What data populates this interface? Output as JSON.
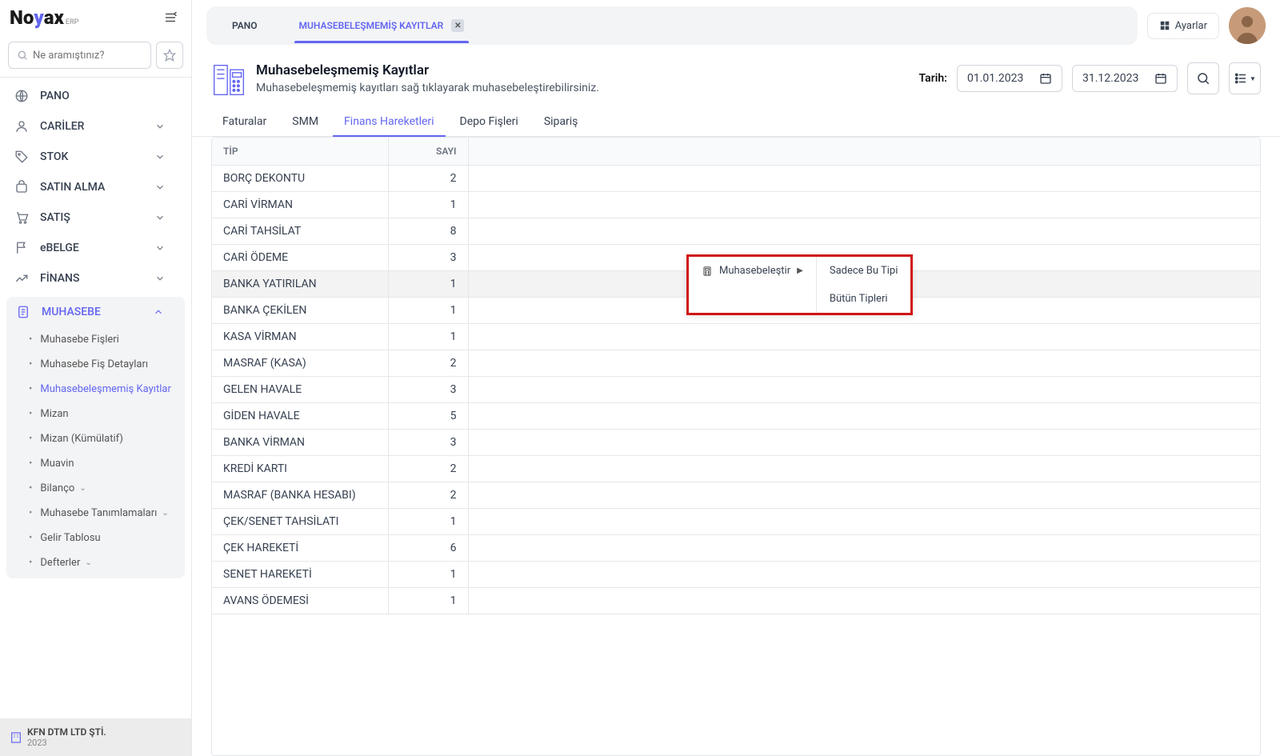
{
  "logo": {
    "part1": "No",
    "part2": "y",
    "part3": "ax",
    "erp": "ERP"
  },
  "search": {
    "placeholder": "Ne aramıştınız?"
  },
  "nav": {
    "pano": "PANO",
    "cariler": "CARİLER",
    "stok": "STOK",
    "satinalma": "SATIN ALMA",
    "satis": "SATIŞ",
    "ebelge": "eBELGE",
    "finans": "FİNANS",
    "muhasebe": "MUHASEBE"
  },
  "muhasebe_sub": {
    "fisler": "Muhasebe Fişleri",
    "fisdetay": "Muhasebe Fiş Detayları",
    "kayitlar": "Muhasebeleşmemiş Kayıtlar",
    "mizan": "Mizan",
    "mizankum": "Mizan (Kümülatif)",
    "muavin": "Muavin",
    "bilanco": "Bilanço",
    "tanimlamalar": "Muhasebe Tanımlamaları",
    "gelir": "Gelir Tablosu",
    "defterler": "Defterler"
  },
  "company": {
    "name": "KFN DTM LTD ŞTİ.",
    "year": "2023"
  },
  "tabs": {
    "pano": "PANO",
    "kayitlar": "MUHASEBELEŞMEMİŞ KAYITLAR"
  },
  "settings": "Ayarlar",
  "page": {
    "title": "Muhasebeleşmemiş Kayıtlar",
    "sub": "Muhasebeleşmemiş kayıtları sağ tıklayarak muhasebeleştirebilirsiniz."
  },
  "date": {
    "label": "Tarih:",
    "from": "01.01.2023",
    "to": "31.12.2023"
  },
  "subtabs": {
    "faturalar": "Faturalar",
    "smm": "SMM",
    "finans": "Finans Hareketleri",
    "depo": "Depo Fişleri",
    "siparis": "Sipariş"
  },
  "cols": {
    "tip": "TİP",
    "sayi": "SAYI"
  },
  "rows": [
    {
      "tip": "BORÇ DEKONTU",
      "sayi": "2",
      "hl": false
    },
    {
      "tip": "CARİ VİRMAN",
      "sayi": "1",
      "hl": false
    },
    {
      "tip": "CARİ TAHSİLAT",
      "sayi": "8",
      "hl": false
    },
    {
      "tip": "CARİ ÖDEME",
      "sayi": "3",
      "hl": false
    },
    {
      "tip": "BANKA YATIRILAN",
      "sayi": "1",
      "hl": true
    },
    {
      "tip": "BANKA ÇEKİLEN",
      "sayi": "1",
      "hl": false
    },
    {
      "tip": "KASA VİRMAN",
      "sayi": "1",
      "hl": false
    },
    {
      "tip": "MASRAF (KASA)",
      "sayi": "2",
      "hl": false
    },
    {
      "tip": "GELEN HAVALE",
      "sayi": "3",
      "hl": false
    },
    {
      "tip": "GİDEN HAVALE",
      "sayi": "5",
      "hl": false
    },
    {
      "tip": "BANKA VİRMAN",
      "sayi": "3",
      "hl": false
    },
    {
      "tip": "KREDİ KARTI",
      "sayi": "2",
      "hl": false
    },
    {
      "tip": "MASRAF (BANKA HESABI)",
      "sayi": "2",
      "hl": false
    },
    {
      "tip": "ÇEK/SENET TAHSİLATI",
      "sayi": "1",
      "hl": false
    },
    {
      "tip": "ÇEK HAREKETİ",
      "sayi": "6",
      "hl": false
    },
    {
      "tip": "SENET HAREKETİ",
      "sayi": "1",
      "hl": false
    },
    {
      "tip": "AVANS ÖDEMESİ",
      "sayi": "1",
      "hl": false
    }
  ],
  "context": {
    "muhasebelestir": "Muhasebeleştir",
    "sadece": "Sadece Bu Tipi",
    "butun": "Bütün Tipleri"
  }
}
